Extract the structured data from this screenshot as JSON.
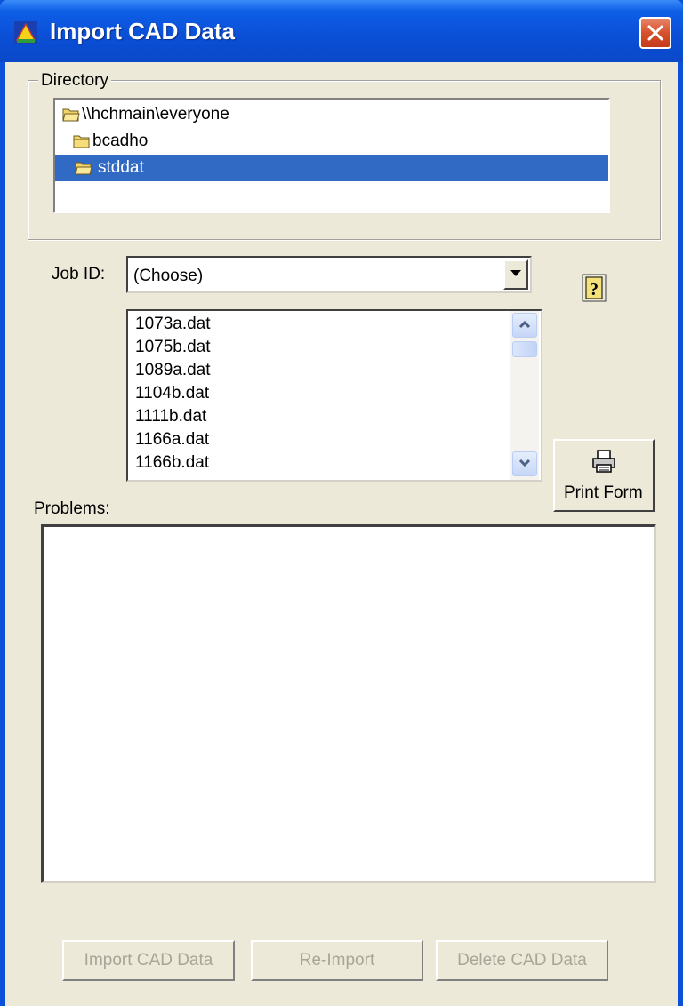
{
  "window": {
    "title": "Import CAD Data"
  },
  "directory": {
    "label": "Directory",
    "items": [
      {
        "label": "\\\\hchmain\\everyone",
        "icon": "open-folder-icon",
        "selected": false
      },
      {
        "label": "bcadho",
        "icon": "folder-icon",
        "selected": false
      },
      {
        "label": "stddat",
        "icon": "open-folder-icon",
        "selected": true
      }
    ]
  },
  "job": {
    "label": "Job ID:",
    "value": "(Choose)",
    "files": [
      "1073a.dat",
      "1075b.dat",
      "1089a.dat",
      "1104b.dat",
      "1111b.dat",
      "1166a.dat",
      "1166b.dat"
    ]
  },
  "print": {
    "label": "Print Form",
    "icon": "printer-icon"
  },
  "problems": {
    "label": "Problems:",
    "text": ""
  },
  "buttons": {
    "import": "Import CAD Data",
    "reimport": "Re-Import",
    "delete": "Delete CAD Data"
  },
  "colors": {
    "titlebar": "#0a4fd6",
    "selection": "#316ac5",
    "face": "#ece9d8",
    "disabled_text": "#a8a598"
  }
}
